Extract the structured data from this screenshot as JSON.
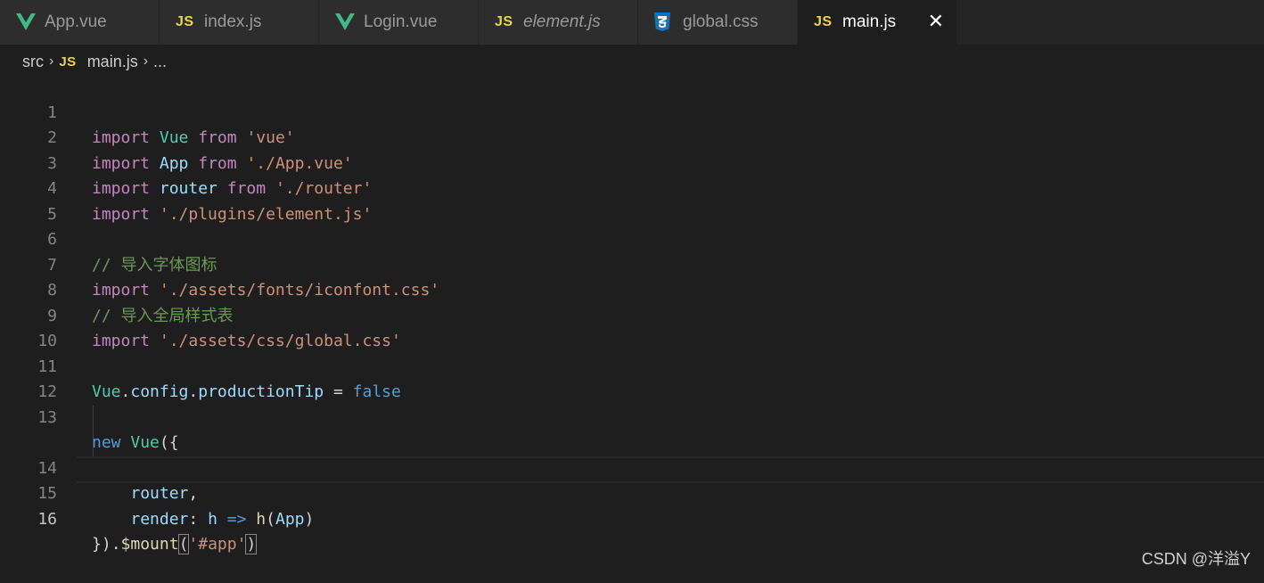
{
  "tabs": [
    {
      "label": "App.vue",
      "icon": "vue-icon",
      "italic": false,
      "active": false
    },
    {
      "label": "index.js",
      "icon": "js-icon",
      "italic": false,
      "active": false
    },
    {
      "label": "Login.vue",
      "icon": "vue-icon",
      "italic": false,
      "active": false
    },
    {
      "label": "element.js",
      "icon": "js-icon",
      "italic": true,
      "active": false
    },
    {
      "label": "global.css",
      "icon": "css3-icon",
      "italic": false,
      "active": false
    },
    {
      "label": "main.js",
      "icon": "js-icon",
      "italic": false,
      "active": true
    }
  ],
  "js_badge": "JS",
  "close_glyph": "✕",
  "breadcrumb": {
    "folder": "src",
    "file": "main.js",
    "rest": "..."
  },
  "code_lines": [
    {
      "num": "1",
      "text": "import Vue from 'vue'"
    },
    {
      "num": "2",
      "text": "import App from './App.vue'"
    },
    {
      "num": "3",
      "text": "import router from './router'"
    },
    {
      "num": "4",
      "text": "import './plugins/element.js'"
    },
    {
      "num": "5",
      "text": ""
    },
    {
      "num": "6",
      "text": "// 导入字体图标"
    },
    {
      "num": "7",
      "text": "import './assets/fonts/iconfont.css'"
    },
    {
      "num": "8",
      "text": "// 导入全局样式表"
    },
    {
      "num": "9",
      "text": "import './assets/css/global.css'"
    },
    {
      "num": "10",
      "text": ""
    },
    {
      "num": "11",
      "text": "Vue.config.productionTip = false"
    },
    {
      "num": "12",
      "text": ""
    },
    {
      "num": "13",
      "text": "new Vue({"
    },
    {
      "num": "14",
      "text": "    router,"
    },
    {
      "num": "15",
      "text": "    render: h => h(App)"
    },
    {
      "num": "16",
      "text": "}).$mount('#app')"
    }
  ],
  "current_line": 16,
  "watermark": "CSDN @洋溢Y",
  "colors": {
    "editor_bg": "#1e1e1e",
    "tab_bg": "#2d2d2d",
    "keyword": "#c586c0",
    "string": "#ce9178",
    "comment": "#6a9955",
    "variable": "#9cdcfe",
    "class": "#4ec9b0",
    "js_icon": "#e8d44d",
    "vue_icon": "#41b883",
    "css_icon": "#1572b6"
  }
}
